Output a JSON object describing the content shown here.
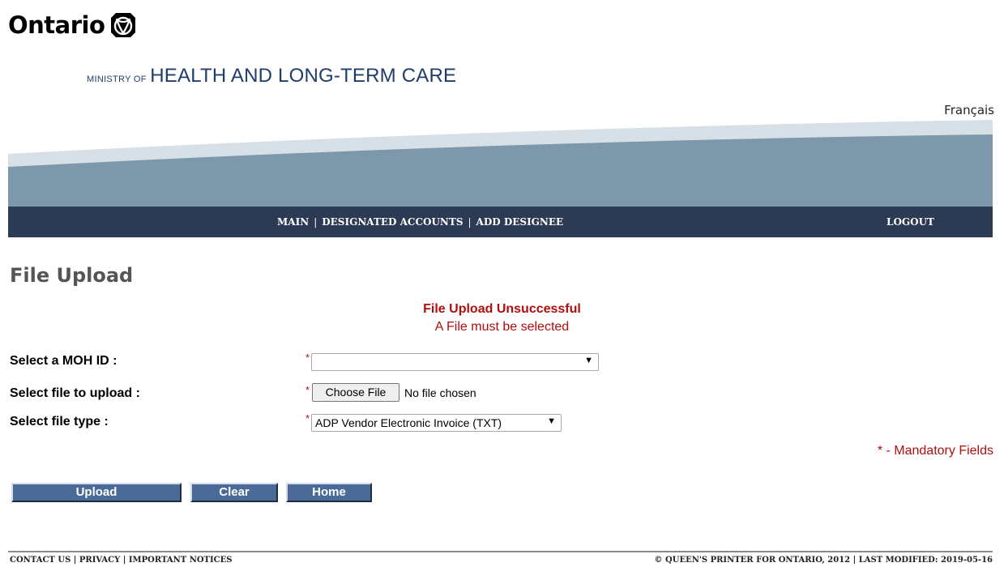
{
  "header": {
    "logo_text": "Ontario",
    "ministry_prefix": "MINISTRY OF",
    "ministry_name": "HEALTH AND LONG-TERM CARE",
    "language_link": "Français"
  },
  "nav": {
    "items": [
      "MAIN",
      "DESIGNATED ACCOUNTS",
      "ADD DESIGNEE"
    ],
    "separator": "|",
    "logout": "LOGOUT"
  },
  "page": {
    "title": "File Upload",
    "message_title": "File Upload Unsuccessful",
    "message_detail": "A File must be selected"
  },
  "form": {
    "required_marker": "*",
    "moh_id_label": "Select a MOH ID :",
    "moh_id_value": "",
    "file_label": "Select file to upload :",
    "choose_file_button": "Choose File",
    "file_status": "No file chosen",
    "file_type_label": "Select file type :",
    "file_type_value": "ADP Vendor Electronic Invoice (TXT)",
    "dropdown_caret": "▼",
    "mandatory_note": "* - Mandatory Fields"
  },
  "actions": {
    "upload": "Upload",
    "clear": "Clear",
    "home": "Home"
  },
  "footer": {
    "links": [
      "CONTACT US",
      "PRIVACY",
      "IMPORTANT NOTICES"
    ],
    "separator": "|",
    "copyright": "© QUEEN'S PRINTER FOR ONTARIO, 2012 | LAST MODIFIED: 2019-05-16"
  },
  "colors": {
    "nav_background": "#2c3a54",
    "swoosh_dark": "#7d98aa",
    "swoosh_light": "#d6e0e6",
    "button_blue": "#4a6a97",
    "error_red": "#b00d0d",
    "ministry_blue": "#1f3d6b"
  },
  "icons": {
    "logo": "ontario-trillium-icon",
    "dropdown": "chevron-down-icon"
  }
}
